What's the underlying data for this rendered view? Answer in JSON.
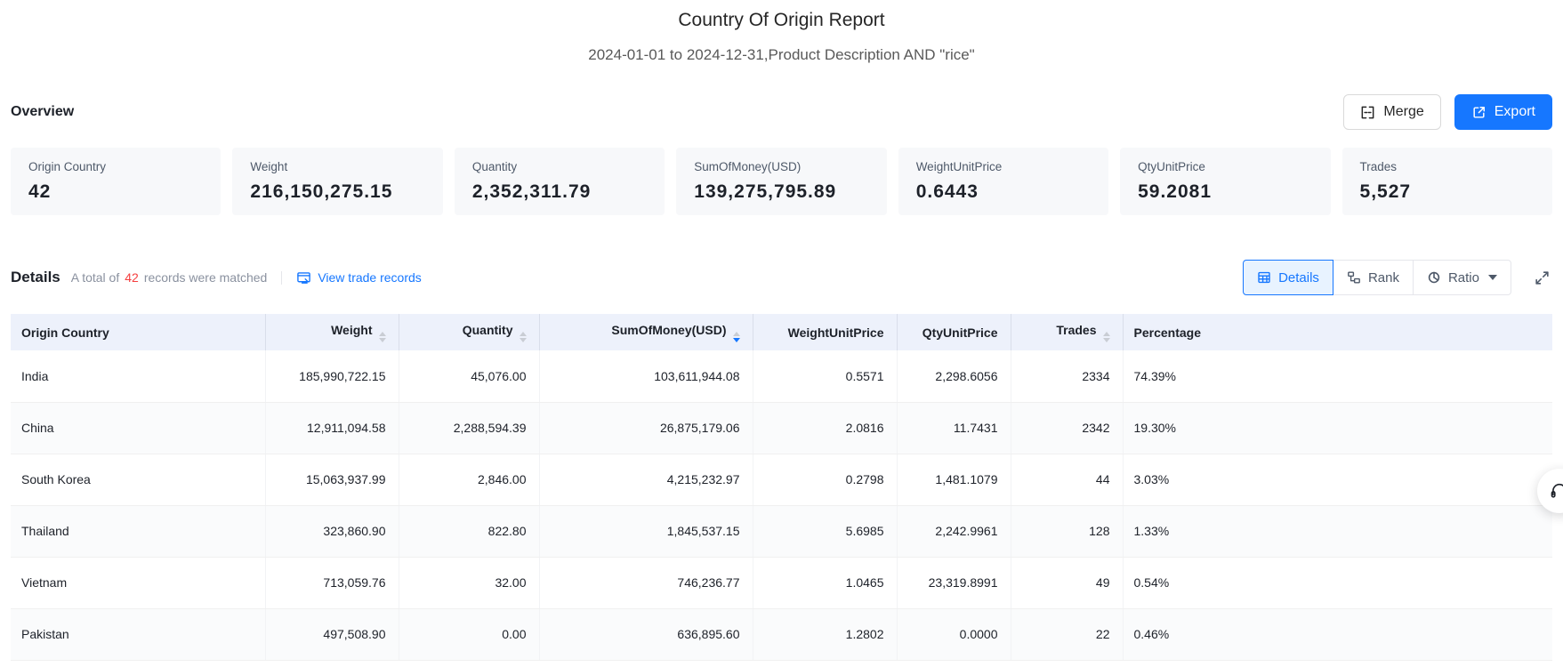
{
  "report": {
    "title": "Country Of Origin Report",
    "subtitle": "2024-01-01 to 2024-12-31,Product Description AND \"rice\""
  },
  "overview": {
    "heading": "Overview",
    "merge_label": "Merge",
    "export_label": "Export",
    "cards": [
      {
        "label": "Origin Country",
        "value": "42"
      },
      {
        "label": "Weight",
        "value": "216,150,275.15"
      },
      {
        "label": "Quantity",
        "value": "2,352,311.79"
      },
      {
        "label": "SumOfMoney(USD)",
        "value": "139,275,795.89"
      },
      {
        "label": "WeightUnitPrice",
        "value": "0.6443"
      },
      {
        "label": "QtyUnitPrice",
        "value": "59.2081"
      },
      {
        "label": "Trades",
        "value": "5,527"
      }
    ]
  },
  "details": {
    "heading": "Details",
    "matched_prefix": "A total of",
    "matched_count": "42",
    "matched_suffix": "records were matched",
    "view_link": "View trade records",
    "tabs": {
      "details": "Details",
      "rank": "Rank",
      "ratio": "Ratio"
    }
  },
  "table": {
    "columns": [
      {
        "label": "Origin Country",
        "sortable": false,
        "sort": null
      },
      {
        "label": "Weight",
        "sortable": true,
        "sort": null
      },
      {
        "label": "Quantity",
        "sortable": true,
        "sort": null
      },
      {
        "label": "SumOfMoney(USD)",
        "sortable": true,
        "sort": "desc"
      },
      {
        "label": "WeightUnitPrice",
        "sortable": false,
        "sort": null
      },
      {
        "label": "QtyUnitPrice",
        "sortable": false,
        "sort": null
      },
      {
        "label": "Trades",
        "sortable": true,
        "sort": null
      },
      {
        "label": "Percentage",
        "sortable": false,
        "sort": null
      }
    ],
    "rows": [
      [
        "India",
        "185,990,722.15",
        "45,076.00",
        "103,611,944.08",
        "0.5571",
        "2,298.6056",
        "2334",
        "74.39%"
      ],
      [
        "China",
        "12,911,094.58",
        "2,288,594.39",
        "26,875,179.06",
        "2.0816",
        "11.7431",
        "2342",
        "19.30%"
      ],
      [
        "South Korea",
        "15,063,937.99",
        "2,846.00",
        "4,215,232.97",
        "0.2798",
        "1,481.1079",
        "44",
        "3.03%"
      ],
      [
        "Thailand",
        "323,860.90",
        "822.80",
        "1,845,537.15",
        "5.6985",
        "2,242.9961",
        "128",
        "1.33%"
      ],
      [
        "Vietnam",
        "713,059.76",
        "32.00",
        "746,236.77",
        "1.0465",
        "23,319.8991",
        "49",
        "0.54%"
      ],
      [
        "Pakistan",
        "497,508.90",
        "0.00",
        "636,895.60",
        "1.2802",
        "0.0000",
        "22",
        "0.46%"
      ]
    ]
  },
  "icons": {
    "merge": "merge-cells-icon",
    "export": "export-icon",
    "view_records": "window-arrow-icon",
    "details_tab": "table-icon",
    "rank_tab": "rank-flow-icon",
    "ratio_tab": "pie-icon",
    "fullscreen": "fullscreen-expand-icon",
    "support": "headset-icon",
    "sort": "sort-carets-icon"
  },
  "colors": {
    "accent_blue": "#1677ff",
    "count_red": "#f53f3f",
    "table_header_bg": "#edf1fb",
    "card_bg": "#f7f8fa",
    "muted_text": "#8a919f"
  }
}
